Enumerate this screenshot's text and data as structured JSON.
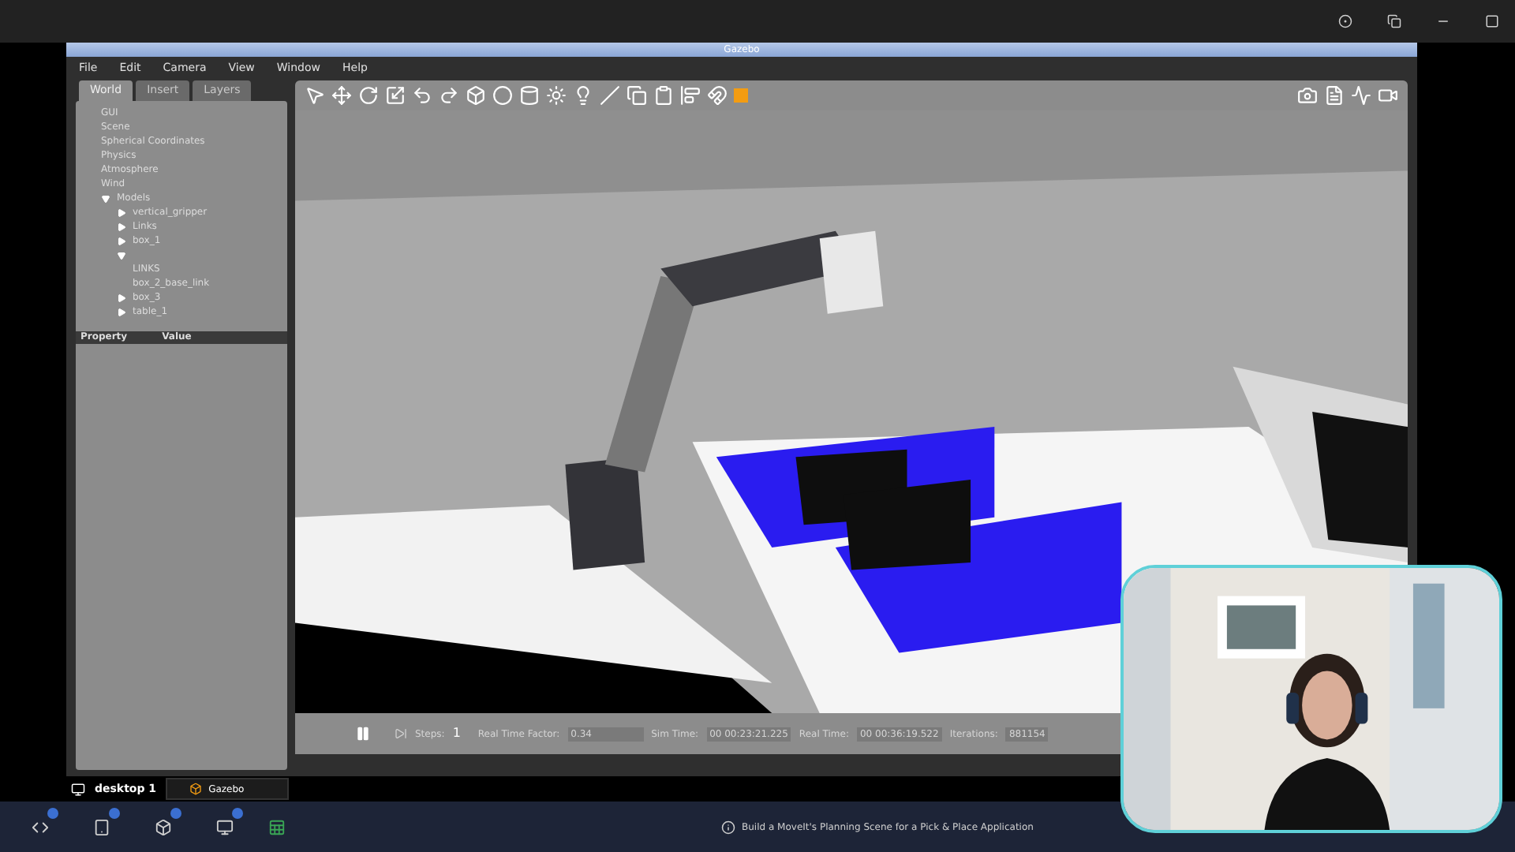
{
  "window": {
    "title": "Gazebo"
  },
  "menu": [
    "File",
    "Edit",
    "Camera",
    "View",
    "Window",
    "Help"
  ],
  "tabs": [
    {
      "label": "World",
      "selected": true
    },
    {
      "label": "Insert",
      "selected": false
    },
    {
      "label": "Layers",
      "selected": false
    }
  ],
  "tree": [
    {
      "label": "GUI"
    },
    {
      "label": "Scene"
    },
    {
      "label": "Spherical Coordinates"
    },
    {
      "label": "Physics"
    },
    {
      "label": "Atmosphere"
    },
    {
      "label": "Wind"
    },
    {
      "label": "Models",
      "expanded": true,
      "children": [
        {
          "label": "vertical_gripper",
          "expanded": false
        },
        {
          "label": "Links",
          "expanded": false
        },
        {
          "label": "box_1",
          "expanded": false
        },
        {
          "expanded": true,
          "children": [
            {
              "label": "LINKS"
            },
            {
              "label": "box_2_base_link"
            }
          ]
        },
        {
          "label": "box_3",
          "expanded": false
        },
        {
          "label": "table_1",
          "expanded": false
        }
      ]
    }
  ],
  "properties": {
    "columns": [
      "Property",
      "Value"
    ]
  },
  "sim_bar": {
    "paused": true,
    "steps_label": "Steps:",
    "steps": "1",
    "rtf_label": "Real Time Factor:",
    "rtf": "0.34",
    "sim_time_label": "Sim Time:",
    "sim_time": "00 00:23:21.225",
    "real_time_label": "Real Time:",
    "real_time": "00 00:36:19.522",
    "iterations_label": "Iterations:",
    "iterations": "881154"
  },
  "desktop": {
    "label": "desktop 1",
    "task": "Gazebo"
  },
  "status": {
    "text": "Build a MoveIt's Planning Scene for a Pick & Place Application"
  }
}
